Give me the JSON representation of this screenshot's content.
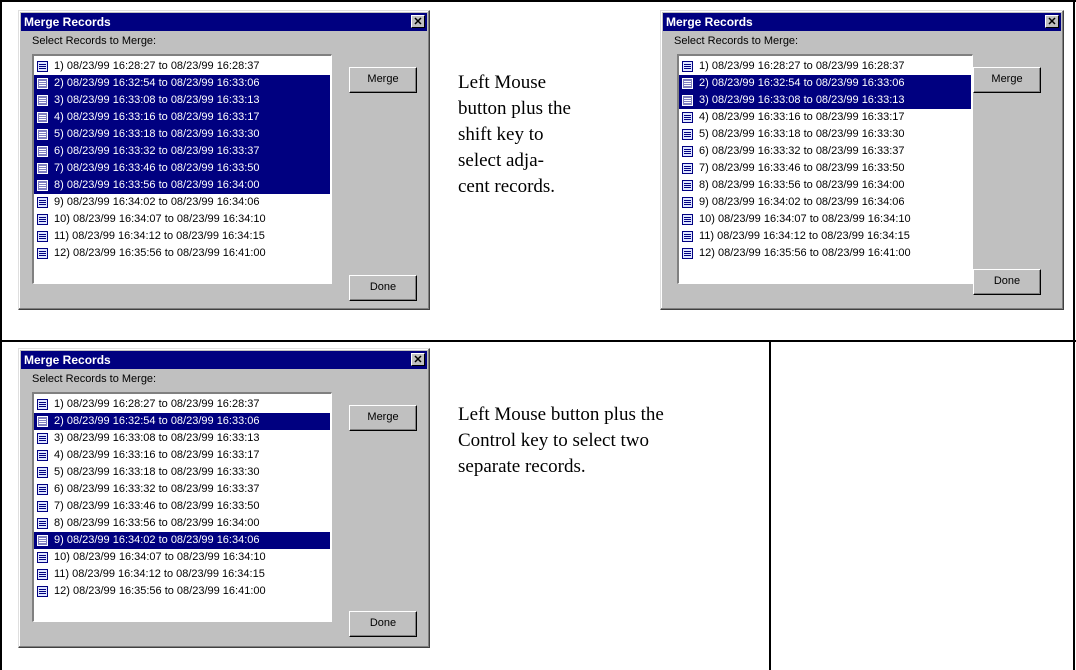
{
  "dialog_title": "Merge Records",
  "close_glyph": "✕",
  "prompt": "Select Records to Merge:",
  "merge_label": "Merge",
  "done_label": "Done",
  "records": [
    "1) 08/23/99 16:28:27 to 08/23/99 16:28:37",
    "2) 08/23/99 16:32:54 to 08/23/99 16:33:06",
    "3) 08/23/99 16:33:08 to 08/23/99 16:33:13",
    "4) 08/23/99 16:33:16 to 08/23/99 16:33:17",
    "5) 08/23/99 16:33:18 to 08/23/99 16:33:30",
    "6) 08/23/99 16:33:32 to 08/23/99 16:33:37",
    "7) 08/23/99 16:33:46 to 08/23/99 16:33:50",
    "8) 08/23/99 16:33:56 to 08/23/99 16:34:00",
    "9) 08/23/99 16:34:02 to 08/23/99 16:34:06",
    "10) 08/23/99 16:34:07 to 08/23/99 16:34:10",
    "11) 08/23/99 16:34:12 to 08/23/99 16:34:15",
    "12) 08/23/99 16:35:56 to 08/23/99 16:41:00"
  ],
  "panels": [
    {
      "selected_indices": [
        1,
        2,
        3,
        4,
        5,
        6,
        7
      ]
    },
    {
      "selected_indices": [
        1,
        2
      ]
    },
    {
      "selected_indices": [
        1,
        8
      ]
    }
  ],
  "captions": {
    "shift": [
      "Left Mouse",
      "button plus the",
      "shift key to",
      "select adja-",
      "cent records."
    ],
    "control": [
      "Left Mouse button plus the",
      "Control key to select two",
      "separate records."
    ]
  },
  "colors": {
    "selection": "#000080",
    "dialog_face": "#c0c0c0"
  }
}
